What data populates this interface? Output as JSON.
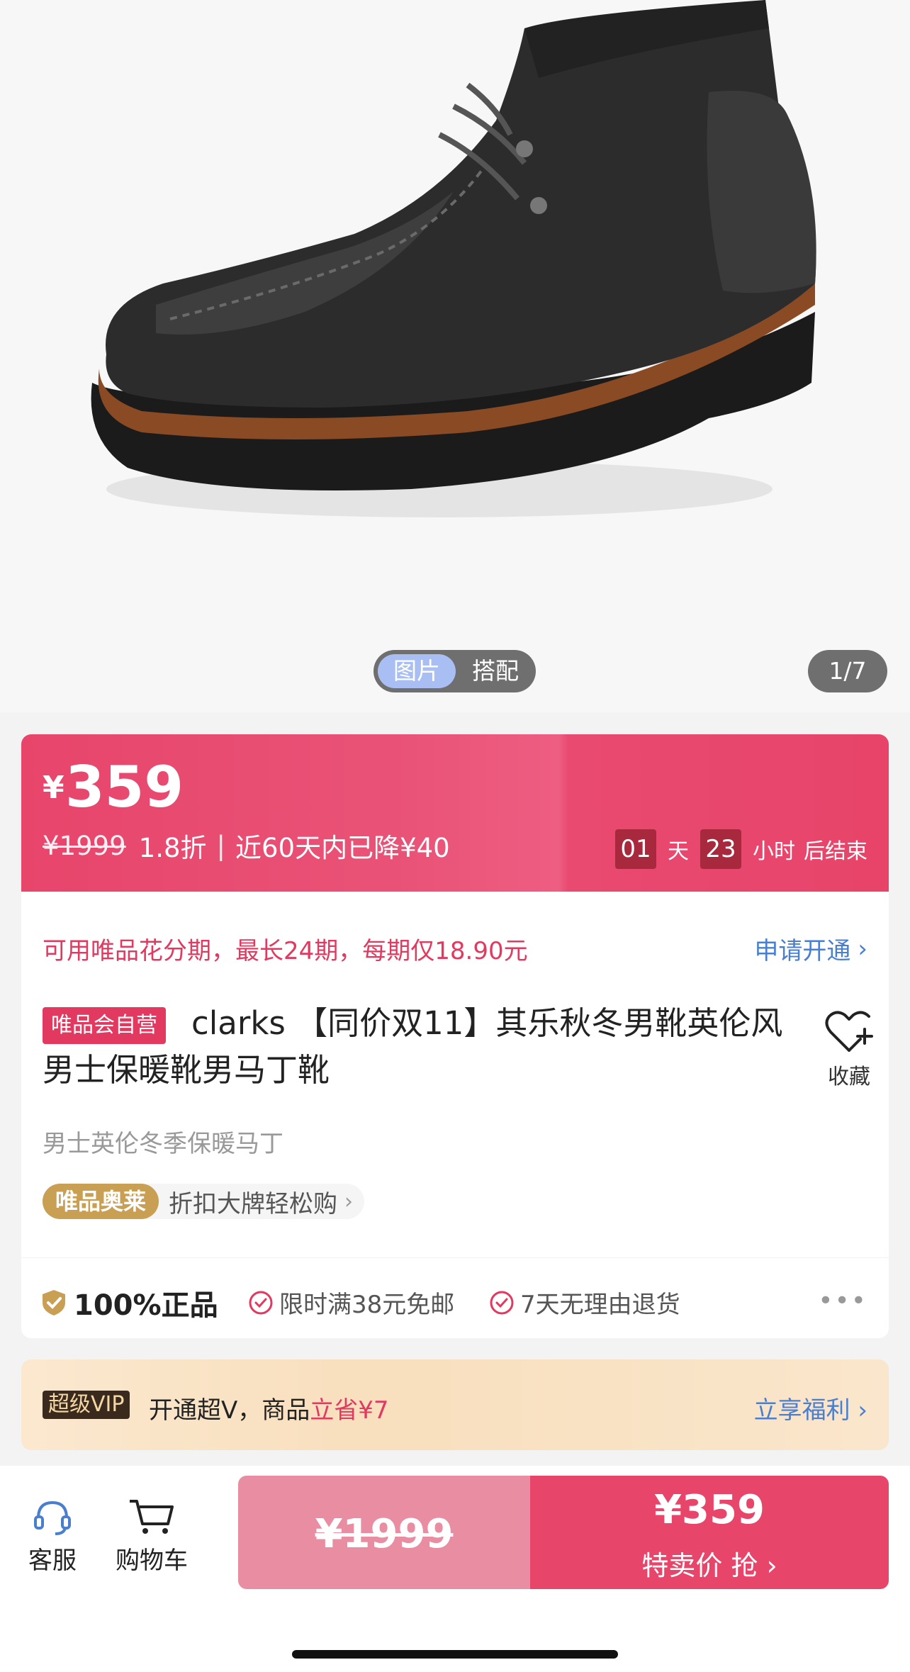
{
  "gallery": {
    "toggle_active": "图片",
    "toggle_other": "搭配",
    "counter": "1/7"
  },
  "price": {
    "symbol": "¥",
    "current": "359",
    "original": "¥1999",
    "discount": "1.8折",
    "separator": "|",
    "drop_note": "近60天内已降¥40",
    "countdown": {
      "days": "01",
      "days_unit": "天",
      "hours": "23",
      "hours_unit": "小时",
      "suffix": "后结束"
    }
  },
  "installment": {
    "text": "可用唯品花分期，最长24期，每期仅18.90元",
    "link": "申请开通",
    "chevron": "›"
  },
  "product": {
    "self_badge": "唯品会自营",
    "title": "clarks 【同价双11】其乐秋冬男靴英伦风男士保暖靴男马丁靴",
    "favorite_label": "收藏",
    "subtitle": "男士英伦冬季保暖马丁",
    "outlet_badge": "唯品奥莱",
    "outlet_text": "折扣大牌轻松购",
    "outlet_chevron": "›"
  },
  "guarantees": {
    "genuine": "100%正品",
    "free_shipping": "限时满38元免邮",
    "returns": "7天无理由退货",
    "more": "•••"
  },
  "vip": {
    "badge": "超级VIP",
    "text": "开通超V，商品",
    "save": "立省¥7",
    "link": "立享福利 ›"
  },
  "bottom_bar": {
    "service_label": "客服",
    "cart_label": "购物车",
    "original_price": "¥1999",
    "sale_price": "¥359",
    "sale_label": "特卖价 抢 ›"
  },
  "colors": {
    "brand_pink": "#e8456b",
    "link_blue": "#4a7fd0",
    "outlet_gold": "#c9a053"
  }
}
